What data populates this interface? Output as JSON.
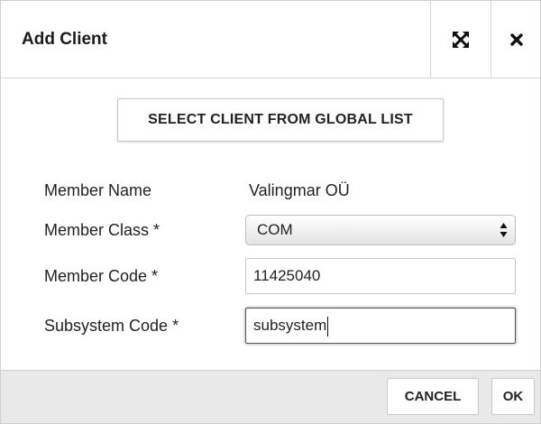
{
  "dialog": {
    "title": "Add Client",
    "expand_icon": "expand-arrows-icon",
    "close_icon": "close-x-icon"
  },
  "select_global_label": "SELECT CLIENT FROM GLOBAL LIST",
  "form": {
    "member_name": {
      "label": "Member Name",
      "value": "Valingmar OÜ"
    },
    "member_class": {
      "label": "Member Class *",
      "value": "COM"
    },
    "member_code": {
      "label": "Member Code *",
      "value": "11425040"
    },
    "subsystem_code": {
      "label": "Subsystem Code *",
      "value": "subsystem"
    }
  },
  "footer": {
    "cancel_label": "CANCEL",
    "ok_label": "OK"
  }
}
